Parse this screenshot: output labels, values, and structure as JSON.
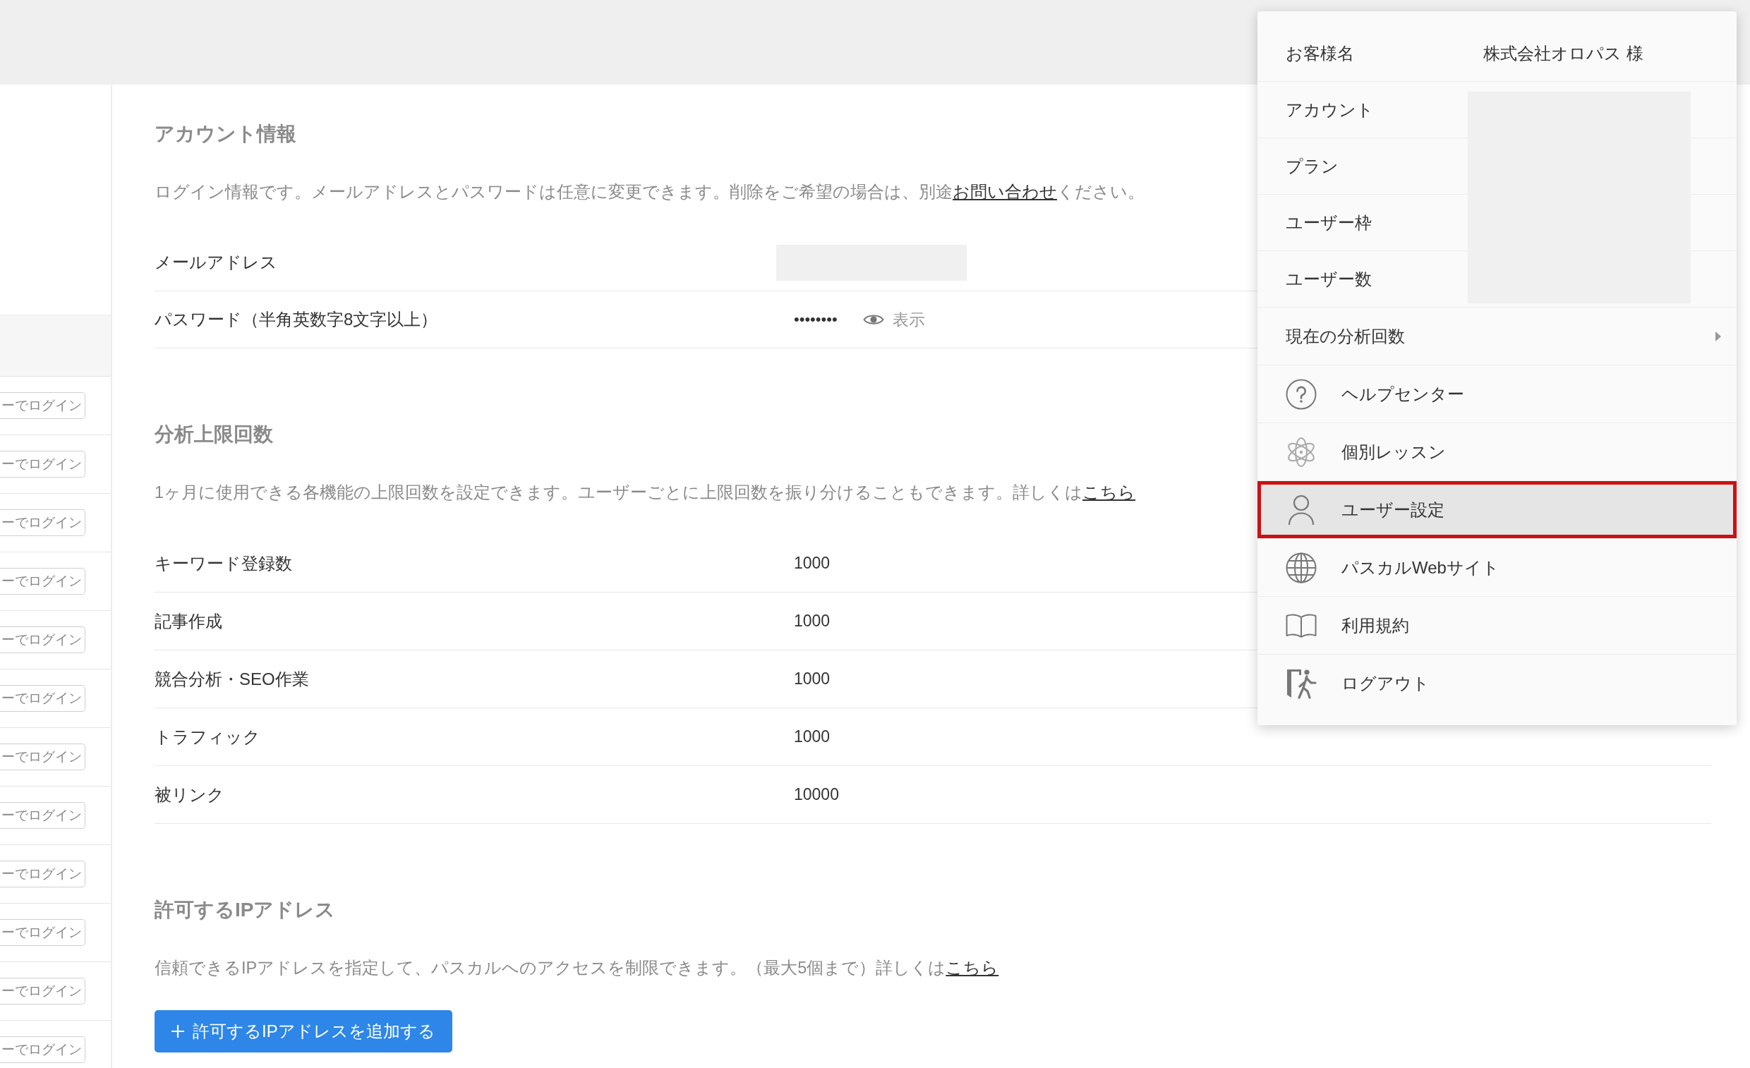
{
  "sidebar": {
    "login_buttons": [
      "ーでログイン",
      "ーでログイン",
      "ーでログイン",
      "ーでログイン",
      "ーでログイン",
      "ーでログイン",
      "ーでログイン",
      "ーでログイン",
      "ーでログイン",
      "ーでログイン",
      "ーでログイン",
      "ーでログイン"
    ]
  },
  "account_section": {
    "heading": "アカウント情報",
    "description": {
      "before": "ログイン情報です。メールアドレスとパスワードは任意に変更できます。削除をご希望の場合は、別途",
      "link": "お問い合わせ",
      "after": "ください。"
    },
    "rows": [
      {
        "label": "メールアドレス",
        "masked": true
      },
      {
        "label": "パスワード（半角英数字8文字以上）",
        "masked": false,
        "value": "••••••••",
        "toggle": "表示"
      }
    ]
  },
  "limits_section": {
    "heading": "分析上限回数",
    "description": {
      "before": "1ヶ月に使用できる各機能の上限回数を設定できます。ユーザーごとに上限回数を振り分けることもできます。詳しくは",
      "link": "こちら"
    },
    "rows": [
      {
        "label": "キーワード登録数",
        "value": "1000"
      },
      {
        "label": "記事作成",
        "value": "1000"
      },
      {
        "label": "競合分析・SEO作業",
        "value": "1000"
      },
      {
        "label": "トラフィック",
        "value": "1000"
      },
      {
        "label": "被リンク",
        "value": "10000"
      }
    ]
  },
  "ip_section": {
    "heading": "許可するIPアドレス",
    "description": {
      "before": "信頼できるIPアドレスを指定して、パスカルへのアクセスを制限できます。（最大5個まで）詳しくは",
      "link": "こちら"
    },
    "add_button": "許可するIPアドレスを追加する"
  },
  "account_menu": {
    "customer": {
      "label": "お客様名",
      "value": "株式会社オロパス 様"
    },
    "masked_rows": [
      "アカウント",
      "プラン",
      "ユーザー枠",
      "ユーザー数"
    ],
    "submenu": {
      "label": "現在の分析回数"
    },
    "items": [
      {
        "label": "ヘルプセンター",
        "selected": false,
        "callout": false
      },
      {
        "label": "個別レッスン",
        "selected": false,
        "callout": false
      },
      {
        "label": "ユーザー設定",
        "selected": true,
        "callout": true
      },
      {
        "label": "パスカルWebサイト",
        "selected": false,
        "callout": false
      },
      {
        "label": "利用規約",
        "selected": false,
        "callout": false
      },
      {
        "label": "ログアウト",
        "selected": false,
        "callout": false
      }
    ]
  }
}
